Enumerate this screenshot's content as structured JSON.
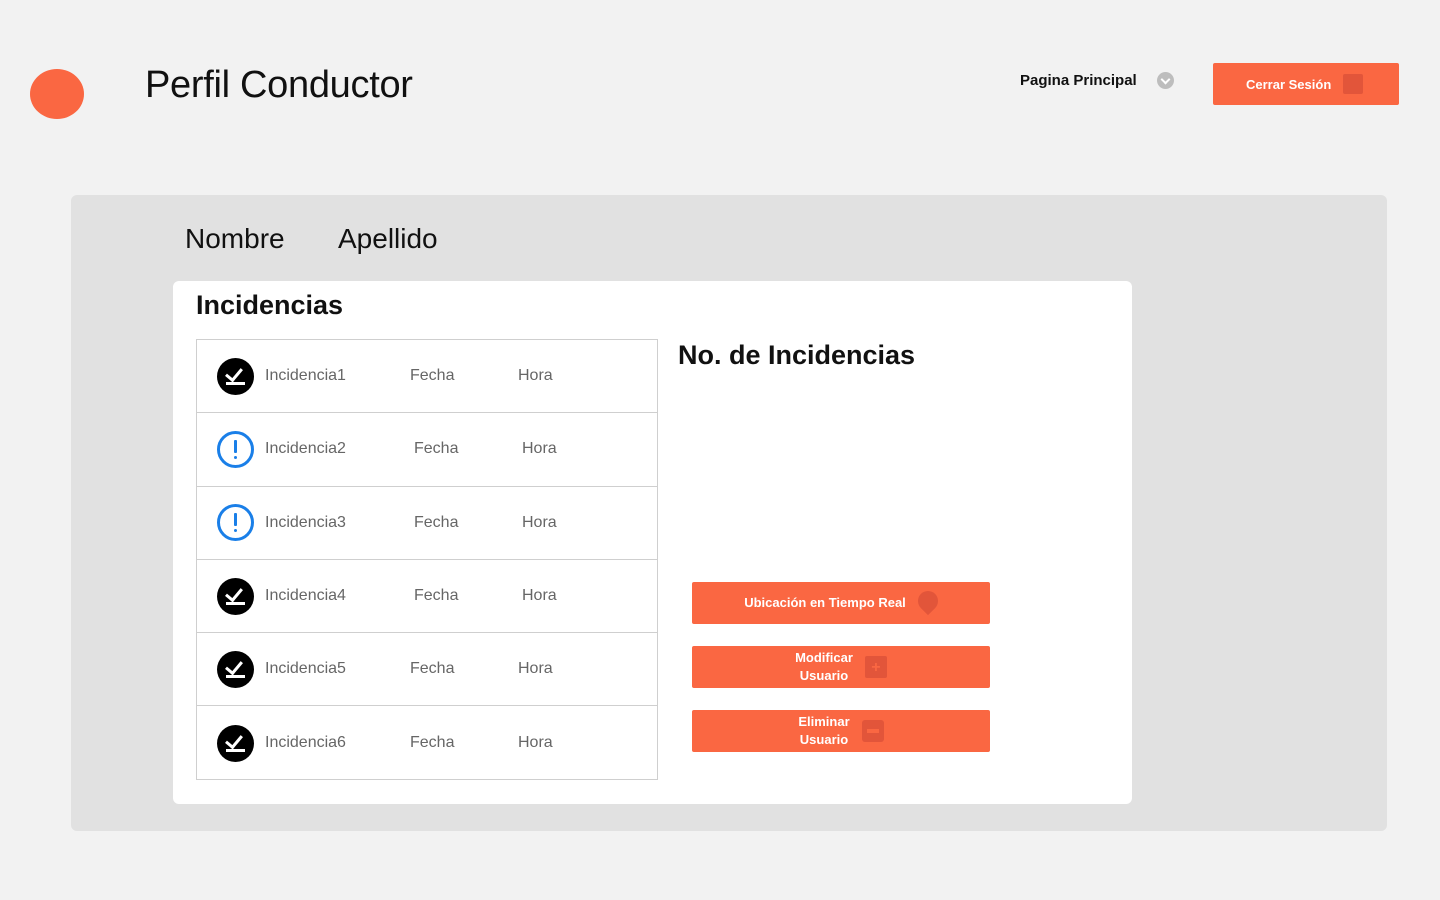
{
  "header": {
    "title": "Perfil Conductor",
    "nav_home_label": "Pagina Principal",
    "logout_label": "Cerrar Sesión"
  },
  "profile": {
    "first_name": "Nombre",
    "last_name": "Apellido"
  },
  "incidents": {
    "title": "Incidencias",
    "count_title": "No. de Incidencias",
    "items": [
      {
        "name": "Incidencia1",
        "date": "Fecha",
        "hour": "Hora",
        "icon": "check-icon"
      },
      {
        "name": "Incidencia2",
        "date": "Fecha",
        "hour": "Hora",
        "icon": "alert-icon"
      },
      {
        "name": "Incidencia3",
        "date": "Fecha",
        "hour": "Hora",
        "icon": "alert-icon"
      },
      {
        "name": "Incidencia4",
        "date": "Fecha",
        "hour": "Hora",
        "icon": "check-icon"
      },
      {
        "name": "Incidencia5",
        "date": "Fecha",
        "hour": "Hora",
        "icon": "check-icon"
      },
      {
        "name": "Incidencia6",
        "date": "Fecha",
        "hour": "Hora",
        "icon": "check-icon"
      }
    ]
  },
  "actions": {
    "location_label": "Ubicación en Tiempo Real",
    "modify_label_line1": "Modificar",
    "modify_label_line2": "Usuario",
    "delete_label_line1": "Eliminar",
    "delete_label_line2": "Usuario"
  },
  "colors": {
    "accent": "#fa6742",
    "alert_blue": "#1a7fe8",
    "panel_bg": "#e1e1e1",
    "page_bg": "#f2f2f2"
  }
}
